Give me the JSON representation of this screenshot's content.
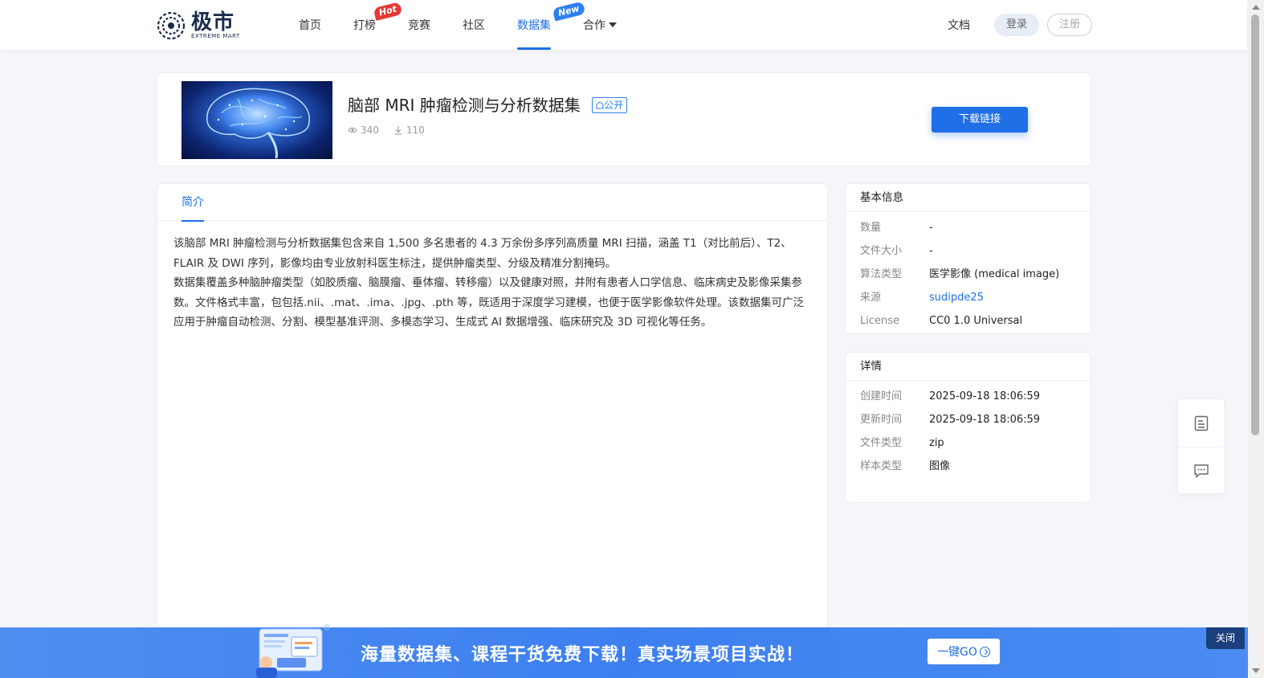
{
  "header": {
    "logo_main": "极市",
    "logo_sub": "EXTREME MART",
    "nav": [
      {
        "label": "首页"
      },
      {
        "label": "打榜",
        "badge": "Hot"
      },
      {
        "label": "竞赛"
      },
      {
        "label": "社区"
      },
      {
        "label": "数据集",
        "badge": "New",
        "active": true
      },
      {
        "label": "合作"
      }
    ],
    "docs": "文档",
    "login": "登录",
    "register": "注册"
  },
  "dataset": {
    "title": "脑部 MRI 肿瘤检测与分析数据集",
    "visibility": "公开",
    "views": "340",
    "downloads": "110",
    "download_button": "下载链接"
  },
  "tabs": {
    "intro": "简介"
  },
  "description": {
    "p1": "该脑部 MRI 肿瘤检测与分析数据集包含来自 1,500 多名患者的 4.3 万余份多序列高质量 MRI 扫描，涵盖 T1（对比前后）、T2、FLAIR 及 DWI 序列，影像均由专业放射科医生标注，提供肿瘤类型、分级及精准分割掩码。",
    "p2": "数据集覆盖多种脑肿瘤类型（如胶质瘤、脑膜瘤、垂体瘤、转移瘤）以及健康对照，并附有患者人口学信息、临床病史及影像采集参数。文件格式丰富，包包括.nii、.mat、.ima、.jpg、.pth 等，既适用于深度学习建模，也便于医学影像软件处理。该数据集可广泛应用于肿瘤自动检测、分割、模型基准评测、多模态学习、生成式 AI 数据增强、临床研究及 3D 可视化等任务。"
  },
  "basic_info": {
    "title": "基本信息",
    "rows": [
      {
        "k": "数量",
        "v": "-"
      },
      {
        "k": "文件大小",
        "v": "-"
      },
      {
        "k": "算法类型",
        "v": "医学影像 (medical image)"
      },
      {
        "k": "来源",
        "v": "sudipde25"
      },
      {
        "k": "License",
        "v": "CC0 1.0 Universal"
      }
    ]
  },
  "details": {
    "title": "详情",
    "rows": [
      {
        "k": "创建时间",
        "v": "2025-09-18 18:06:59"
      },
      {
        "k": "更新时间",
        "v": "2025-09-18 18:06:59"
      },
      {
        "k": "文件类型",
        "v": "zip"
      },
      {
        "k": "样本类型",
        "v": "图像"
      }
    ]
  },
  "float_tools": {
    "icons": [
      "document-icon",
      "comment-icon"
    ]
  },
  "banner": {
    "text": "海量数据集、课程干货免费下载！真实场景项目实战！",
    "button": "一键GO",
    "close": "关闭"
  },
  "colors": {
    "accent": "#1f6fe6",
    "hot_badge": "#e53935",
    "new_badge": "#2f80ed",
    "banner_bg": "#4a8cf2",
    "close_bg": "#1b3f7d"
  }
}
